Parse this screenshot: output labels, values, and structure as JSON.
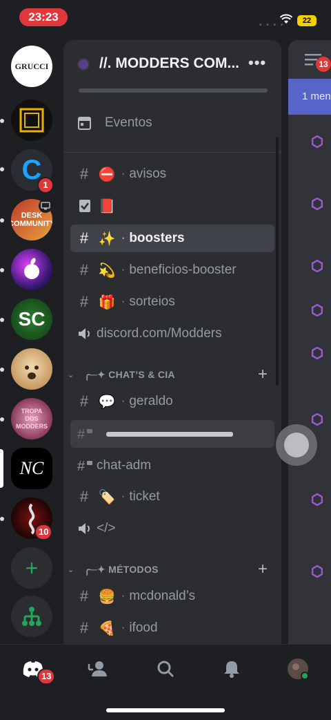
{
  "status": {
    "time": "23:23",
    "battery": "22"
  },
  "guilds": [
    {
      "name": "GRUCCI",
      "label": "GRUCCI"
    },
    {
      "name": "square-logo",
      "label": ""
    },
    {
      "name": "c-server",
      "label": "C",
      "badge": "1"
    },
    {
      "name": "desk-community",
      "label": "DESK COMMUNITY"
    },
    {
      "name": "apple-server",
      "label": ""
    },
    {
      "name": "sc-server",
      "label": "SC"
    },
    {
      "name": "cat-server",
      "label": ""
    },
    {
      "name": "tropa-dos-modders",
      "label": "TROPA DOS MODDERS"
    },
    {
      "name": "nc-server",
      "label": "NC"
    },
    {
      "name": "dark-server",
      "label": "",
      "badge": "10"
    }
  ],
  "server": {
    "name": "//. MODDERS COM...",
    "more": "•••"
  },
  "events_label": "Eventos",
  "channels": {
    "avisos": {
      "emoji": "⛔",
      "sep": "·",
      "name": "avisos"
    },
    "rules": {
      "emoji": "📕"
    },
    "boosters": {
      "emoji": "✨",
      "sep": "·",
      "name": "boosters"
    },
    "beneficios": {
      "emoji": "💫",
      "sep": "·",
      "name": "beneficios-booster"
    },
    "sorteios": {
      "emoji": "🎁",
      "sep": "·",
      "name": "sorteios"
    },
    "discord": {
      "name": "discord.com/Modders"
    },
    "geraldo": {
      "emoji": "💬",
      "sep": "·",
      "name": "geraldo"
    },
    "chatadm": {
      "name": "chat-adm"
    },
    "ticket": {
      "emoji": "🏷️",
      "sep": "·",
      "name": "ticket"
    },
    "code": {
      "name": "</>"
    },
    "mcdonalds": {
      "emoji": "🍔",
      "sep": "·",
      "name": "mcdonald’s"
    },
    "ifood": {
      "emoji": "🍕",
      "sep": "·",
      "name": "ifood"
    }
  },
  "categories": {
    "chat": {
      "label": "╭─✦ CHAT’S & CIA"
    },
    "metodos": {
      "label": "╭─✦ MÉTODOS"
    }
  },
  "symbols": {
    "hash": "#",
    "plus": "+",
    "chevron": "⌄",
    "add_server": "+"
  },
  "right_strip": {
    "badge": "13",
    "banner": "1 men"
  },
  "bottom_nav": {
    "home_badge": "13"
  },
  "colors": {
    "accent": "#5865f2",
    "badge": "#e0373b",
    "green": "#23a55a"
  }
}
